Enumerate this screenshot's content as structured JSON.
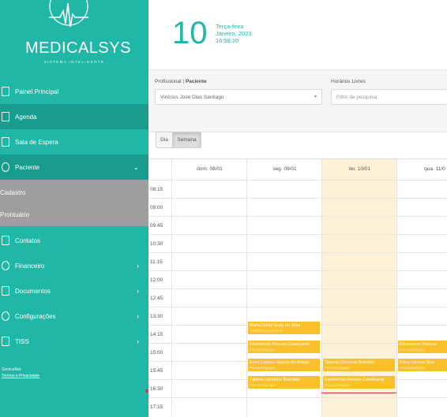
{
  "sidebar": {
    "logo": {
      "text": "MEDICALSYS",
      "subtitle": "SISTEMA INTELIGENTE"
    },
    "items": [
      {
        "label": "Painel Principal",
        "icon": "tablet-icon",
        "chevron": ""
      },
      {
        "label": "Agenda",
        "icon": "calendar-icon",
        "chevron": ""
      },
      {
        "label": "Sala de Espera",
        "icon": "clock-icon",
        "chevron": ""
      },
      {
        "label": "Paciente",
        "icon": "user-icon",
        "chevron": "⌄"
      },
      {
        "label": "Cadastro",
        "icon": "",
        "chevron": ""
      },
      {
        "label": "Prontuário",
        "icon": "",
        "chevron": ""
      },
      {
        "label": "Contatos",
        "icon": "phone-icon",
        "chevron": ""
      },
      {
        "label": "Financeiro",
        "icon": "money-icon",
        "chevron": "›"
      },
      {
        "label": "Documentos",
        "icon": "document-icon",
        "chevron": "›"
      },
      {
        "label": "Configurações",
        "icon": "gear-icon",
        "chevron": "›"
      },
      {
        "label": "TISS",
        "icon": "tiss-icon",
        "chevron": "›"
      }
    ],
    "footer": {
      "line1": "ServiceNet",
      "line2": "Termos e Privacidade"
    }
  },
  "header": {
    "day": "10",
    "weekday": "Terça-feira",
    "month_year": "Janeiro, 2023",
    "time": "16:58:10"
  },
  "filters": {
    "professional_label": "Profissional",
    "patient_label": "Paciente",
    "separator": "|",
    "professional_value": "Vinícius José Dias Santiago",
    "free_slots_label": "Horários Livres",
    "search_placeholder": "Filtro de pesquisa"
  },
  "view": {
    "day_label": "Dia",
    "week_label": "Semana",
    "active": "Semana"
  },
  "calendar": {
    "days": [
      "dom. 08/01",
      "seg. 09/01",
      "ter. 10/01",
      "qua. 11/0"
    ],
    "today_index": 2,
    "times": [
      "08:15",
      "09:00",
      "09:45",
      "10:30",
      "11:15",
      "12:00",
      "12:45",
      "13:30",
      "14:15",
      "15:00",
      "15:45",
      "16:30",
      "17:15"
    ],
    "events": [
      {
        "title": "Maria Daisy Quity da Silva",
        "sub": "Terapia Ocupacional"
      },
      {
        "title": "Elismerces Pessoa Cavalcante",
        "sub": "Psicopedagogia"
      },
      {
        "title": "Érica Larissa Soares de Araújo",
        "sub": "Psicopedagogia"
      },
      {
        "title": "Tatiana Christina Brandão",
        "sub": "Psicopedagogia"
      },
      {
        "title": "Tatiana Christina Brandão",
        "sub": "Psicopedagogia"
      },
      {
        "title": "Elismerces Pessoa Cavalcante",
        "sub": "Psicopedagogia"
      },
      {
        "title": "Elismerces Pessoa",
        "sub": "Psicopedagogia"
      },
      {
        "title": "Érica Larissa Soar",
        "sub": "Psicopedagogia"
      }
    ]
  },
  "colors": {
    "brand": "#20b7a6",
    "active_nav": "#199b8e",
    "sub_nav": "#9e9e9e",
    "event": "#f9c02a",
    "today": "#fdf2d7",
    "now_line": "#dd3333"
  }
}
